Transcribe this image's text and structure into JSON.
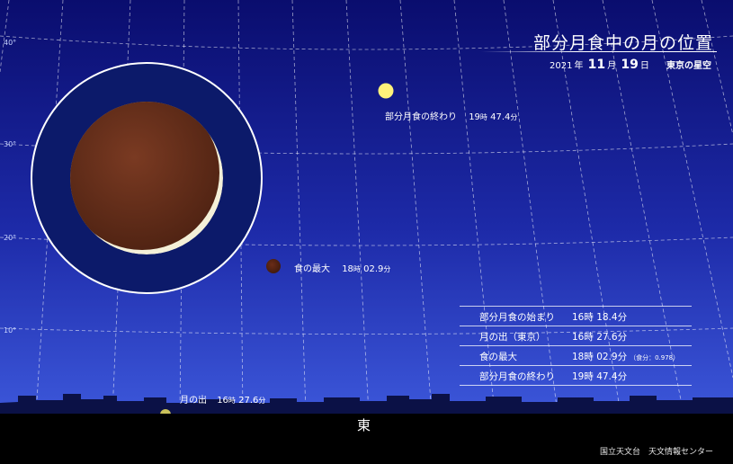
{
  "title": "部分月食中の月の位置",
  "date": {
    "year": "2021",
    "year_unit": "年",
    "month": "11",
    "month_unit": "月",
    "day": "19",
    "day_unit": "日",
    "place": "東京の星空"
  },
  "altitude_labels": [
    "40°",
    "30°",
    "20°",
    "10°"
  ],
  "direction": "東",
  "moon_labels": {
    "end": {
      "name": "部分月食の終わり",
      "hour": "19",
      "hour_unit": "時",
      "min": "47.4",
      "min_unit": "分"
    },
    "max": {
      "name": "食の最大",
      "hour": "18",
      "hour_unit": "時",
      "min": "02.9",
      "min_unit": "分"
    },
    "rise": {
      "name": "月の出",
      "hour": "16",
      "hour_unit": "時",
      "min": "27.6",
      "min_unit": "分"
    }
  },
  "table": [
    {
      "name": "部分月食の始まり",
      "time": "16時 18.4分",
      "note": ""
    },
    {
      "name": "月の出（東京）",
      "time": "16時 27.6分",
      "note": ""
    },
    {
      "name": "食の最大",
      "time": "18時 02.9分",
      "note": "（食分：0.978）"
    },
    {
      "name": "部分月食の終わり",
      "time": "19時 47.4分",
      "note": ""
    }
  ],
  "credit": "国立天文台　天文情報センター",
  "colors": {
    "sky_top": "#0a0d6e",
    "sky_bottom": "#3a52d6",
    "moon_eclipsed": "#6b2f1a",
    "moon_full": "#fff27a",
    "ground": "#000000"
  }
}
